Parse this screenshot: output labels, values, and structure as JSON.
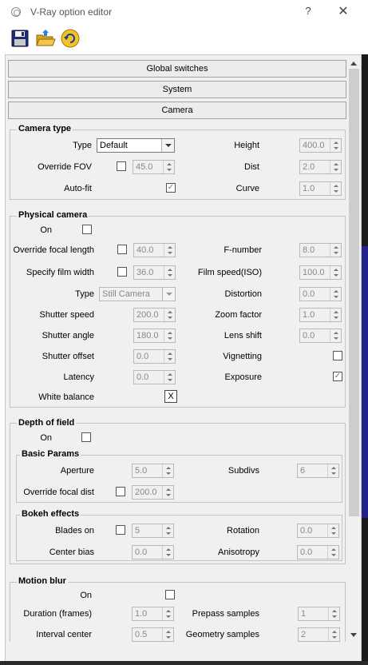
{
  "window": {
    "title": "V-Ray option editor",
    "help": "?",
    "close": "✕"
  },
  "toolbar": {
    "open_icon": "save-icon",
    "folder_icon": "open-folder-icon",
    "refresh_icon": "refresh-icon"
  },
  "rollouts": {
    "global": "Global switches",
    "system": "System",
    "camera": "Camera"
  },
  "camera_type": {
    "title": "Camera type",
    "type_label": "Type",
    "type_value": "Default",
    "override_fov_label": "Override FOV",
    "override_fov_checked": false,
    "fov_value": "45.0",
    "autofit_label": "Auto-fit",
    "autofit_checked": true,
    "height_label": "Height",
    "height_value": "400.0",
    "dist_label": "Dist",
    "dist_value": "2.0",
    "curve_label": "Curve",
    "curve_value": "1.0"
  },
  "physical_camera": {
    "title": "Physical camera",
    "on_label": "On",
    "on_checked": false,
    "override_focal_label": "Override focal length",
    "override_focal_checked": false,
    "focal_value": "40.0",
    "film_width_label": "Specify film width",
    "film_width_checked": false,
    "film_width_value": "36.0",
    "type_label": "Type",
    "type_value": "Still Camera",
    "shutter_speed_label": "Shutter speed",
    "shutter_speed_value": "200.0",
    "shutter_angle_label": "Shutter angle",
    "shutter_angle_value": "180.0",
    "shutter_offset_label": "Shutter offset",
    "shutter_offset_value": "0.0",
    "latency_label": "Latency",
    "latency_value": "0.0",
    "white_balance_label": "White balance",
    "white_balance_button": "X",
    "fnumber_label": "F-number",
    "fnumber_value": "8.0",
    "film_speed_label": "Film speed(ISO)",
    "film_speed_value": "100.0",
    "distortion_label": "Distortion",
    "distortion_value": "0.0",
    "zoom_label": "Zoom factor",
    "zoom_value": "1.0",
    "lens_shift_label": "Lens shift",
    "lens_shift_value": "0.0",
    "vignetting_label": "Vignetting",
    "vignetting_checked": false,
    "exposure_label": "Exposure",
    "exposure_checked": true
  },
  "depth_of_field": {
    "title": "Depth of field",
    "on_label": "On",
    "on_checked": false,
    "basic_title": "Basic Params",
    "aperture_label": "Aperture",
    "aperture_value": "5.0",
    "subdivs_label": "Subdivs",
    "subdivs_value": "6",
    "override_focal_dist_label": "Override focal dist",
    "override_focal_dist_checked": false,
    "focal_dist_value": "200.0",
    "bokeh_title": "Bokeh effects",
    "blades_label": "Blades on",
    "blades_checked": false,
    "blades_value": "5",
    "rotation_label": "Rotation",
    "rotation_value": "0.0",
    "center_bias_label": "Center bias",
    "center_bias_value": "0.0",
    "anisotropy_label": "Anisotropy",
    "anisotropy_value": "0.0"
  },
  "motion_blur": {
    "title": "Motion blur",
    "on_label": "On",
    "on_checked": false,
    "duration_label": "Duration (frames)",
    "duration_value": "1.0",
    "interval_label": "Interval center",
    "interval_value": "0.5",
    "prepass_label": "Prepass samples",
    "prepass_value": "1",
    "geometry_label": "Geometry samples",
    "geometry_value": "2"
  }
}
